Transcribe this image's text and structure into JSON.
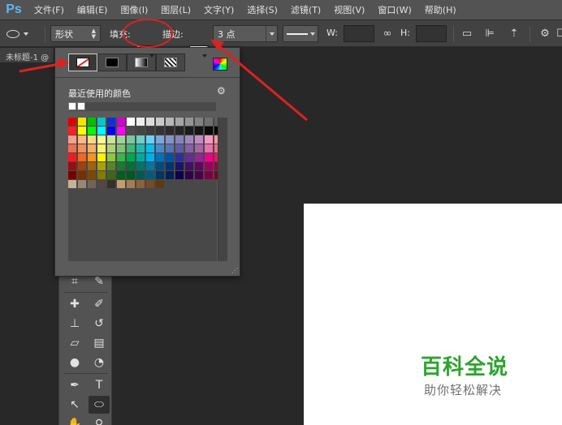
{
  "app": {
    "logo": "Ps"
  },
  "menu": [
    "文件(F)",
    "编辑(E)",
    "图像(I)",
    "图层(L)",
    "文字(Y)",
    "选择(S)",
    "滤镜(T)",
    "视图(V)",
    "窗口(W)",
    "帮助(H)"
  ],
  "options": {
    "mode": "形状",
    "fill_label": "填充:",
    "stroke_label": "描边:",
    "stroke_width": "3 点",
    "w_label": "W:",
    "h_label": "H:"
  },
  "document": {
    "tab_title": "未标题-1 @"
  },
  "swatch_panel": {
    "title": "最近使用的颜色",
    "fill_types": [
      "无颜色",
      "纯色",
      "渐变",
      "图案"
    ],
    "selected_type": "无颜色",
    "recent_colors": [
      "#ffffff",
      "#ffffff"
    ],
    "swatches": [
      "#e00000",
      "#f2e600",
      "#00c000",
      "#00c8c8",
      "#1030d0",
      "#d000d0",
      "#ffffff",
      "#eeeeee",
      "#dcdcdc",
      "#cacaca",
      "#b8b8b8",
      "#a6a6a6",
      "#949494",
      "#828282",
      "#707070",
      "#5e5e5e",
      "#ff2020",
      "#ffff00",
      "#00ff00",
      "#00ffff",
      "#0000ff",
      "#ff00ff",
      "#4c4c4c",
      "#444444",
      "#3c3c3c",
      "#343434",
      "#2c2c2c",
      "#242424",
      "#1c1c1c",
      "#141414",
      "#0a0a0a",
      "#000000",
      "#f6a08c",
      "#f8b88a",
      "#fcd88c",
      "#fff89a",
      "#c8e39c",
      "#a0d39c",
      "#7cc6a0",
      "#70cdc8",
      "#6ccff6",
      "#7da7d9",
      "#8393ca",
      "#8781bd",
      "#a186be",
      "#bd8cbf",
      "#f49ac1",
      "#f5989d",
      "#f26c4f",
      "#f68e55",
      "#fbaf5c",
      "#fff467",
      "#acd372",
      "#7cc576",
      "#3bb878",
      "#1abbb4",
      "#00bff3",
      "#438ccb",
      "#5574b9",
      "#605ca8",
      "#855fa8",
      "#a763a8",
      "#f06ea9",
      "#f26d7d",
      "#ed1c24",
      "#f26522",
      "#f7941d",
      "#fff200",
      "#8dc63f",
      "#39b54a",
      "#00a651",
      "#00a99d",
      "#00aeef",
      "#0072bc",
      "#0054a6",
      "#2e3192",
      "#662d91",
      "#92278f",
      "#ec008c",
      "#ed145b",
      "#9e0b0f",
      "#a0410d",
      "#a3620a",
      "#aba000",
      "#598527",
      "#1a7b30",
      "#007236",
      "#00746b",
      "#0076a3",
      "#004b80",
      "#003471",
      "#1b1464",
      "#440e62",
      "#630460",
      "#9e005d",
      "#9e0039",
      "#790000",
      "#7b2e00",
      "#7d4900",
      "#827b00",
      "#406618",
      "#005e20",
      "#005826",
      "#005952",
      "#005b7f",
      "#003663",
      "#002157",
      "#0d004c",
      "#32004b",
      "#4b0049",
      "#7b0046",
      "#7a0026",
      "#c7b299",
      "#998675",
      "#736357",
      "#534741",
      "#37302a",
      "#c69c6d",
      "#a67c52",
      "#8c6239",
      "#754c24",
      "#603913"
    ]
  },
  "watermark": {
    "title": "百科全说",
    "subtitle": "助你轻松解决"
  },
  "colors": {
    "menubar": "#535353",
    "options": "#424242",
    "canvas_bg": "#282828",
    "annotation": "#e02020",
    "watermark_green": "#2ca42e"
  }
}
